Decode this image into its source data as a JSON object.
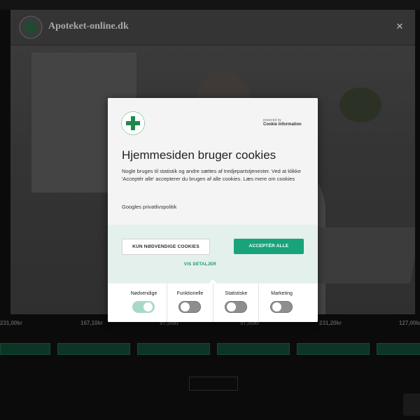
{
  "background": {
    "topbar": {
      "left_text": "",
      "right_text": ""
    },
    "products": [
      {
        "price": "231,00kr",
        "note": "",
        "buy_label": ""
      },
      {
        "price": "167,10kr",
        "note": "",
        "buy_label": ""
      },
      {
        "price": "97,00kr",
        "note": "",
        "buy_label": ""
      },
      {
        "price": "97,00kr",
        "note": "",
        "buy_label": ""
      },
      {
        "price": "231,20kr",
        "note": "",
        "buy_label": ""
      },
      {
        "price": "127,00kr",
        "note": "",
        "buy_label": ""
      }
    ],
    "more_button_label": ""
  },
  "product_modal": {
    "site_title": "Apoteket-online.dk",
    "close_icon": "close-icon",
    "logo_icon": "apoteket-logo-icon"
  },
  "cookie_dialog": {
    "powered_by": "powered by",
    "provider": "Cookie Information",
    "title": "Hjemmesiden bruger cookies",
    "description": "Nogle bruges til statistik og andre sættes af tredjepartstjenester. Ved at klikke 'Acceptér alle' accepterer du brugen af alle cookies. Læs mere om cookies",
    "privacy_link": "Googles privatlivspolitik",
    "necessary_button": "KUN NØDVENDIGE COOKIES",
    "accept_button": "ACCEPTÉR ALLE",
    "details_link": "VIS DETALJER",
    "toggles": [
      {
        "label": "Nødvendige",
        "on": true
      },
      {
        "label": "Funktionelle",
        "on": false
      },
      {
        "label": "Statistiske",
        "on": false
      },
      {
        "label": "Marketing",
        "on": false
      }
    ]
  },
  "colors": {
    "accent": "#18a37c",
    "action_area": "#e4f0ec",
    "toggle_on": "#a9d8c6",
    "toggle_off": "#8e8e8e",
    "logo_green": "#1d8a4c"
  }
}
